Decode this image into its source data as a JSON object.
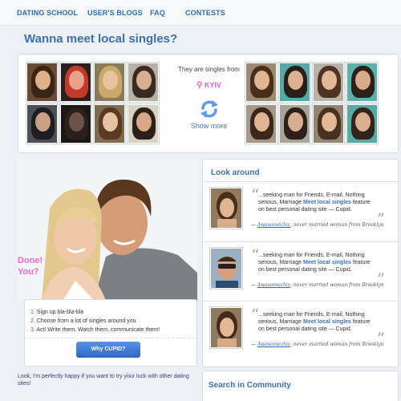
{
  "nav": {
    "items": [
      {
        "label": "DATING SCHOOL"
      },
      {
        "label": "USER'S BLOGS"
      },
      {
        "label": "FAQ"
      },
      {
        "label": "CONTESTS"
      }
    ]
  },
  "headline": "Wanna meet local singles?",
  "gallery": {
    "from_label": "They are singles from",
    "city": "KYIV",
    "show_more": "Show more"
  },
  "promo": {
    "overlay_text": "Done! You?",
    "steps": [
      {
        "num": "1.",
        "text": "Sign up bla-bla-bla"
      },
      {
        "num": "2.",
        "text": "Choose from a lot of singles around you"
      },
      {
        "num": "3.",
        "text": "Act! Write them, Watch them, communicate them!"
      }
    ],
    "button_label": "Why CUPID?",
    "footer_note": "Look, I'm perfectly happy if you want to try your luck with other dating sites!"
  },
  "look_around": {
    "title": "Look around",
    "entries": [
      {
        "text_before": "...seeking man for Friends, E-mail, Nothing serious, Marriage ",
        "highlight": "Meet local singles",
        "text_after": " feature on best personal dating site — Cupid.",
        "sig_prefix": "— ",
        "sig_user": "Awesomechic",
        "sig_rest": ", never married woman from Brooklyn"
      },
      {
        "text_before": "...seeking man for Friends, E-mail, Nothing serious, Marriage ",
        "highlight": "Meet local singles",
        "text_after": " feature on best personal dating site — Cupid.",
        "sig_prefix": "— ",
        "sig_user": "Awesomechic",
        "sig_rest": ", never married woman from Brooklyn"
      },
      {
        "text_before": "...seeking man for Friends, E-mail, Nothing serious, Marriage ",
        "highlight": "Meet local singles",
        "text_after": " feature on best personal dating site — Cupid.",
        "sig_prefix": "— ",
        "sig_user": "Awesomechic",
        "sig_rest": ", never married woman from Brooklyn"
      }
    ]
  },
  "search": {
    "title": "Search in Community"
  },
  "colors": {
    "link_blue": "#2f6ac2",
    "heading_blue": "#3e6fb5",
    "pink": "#e85ec0",
    "step_red": "#d13a3a"
  }
}
